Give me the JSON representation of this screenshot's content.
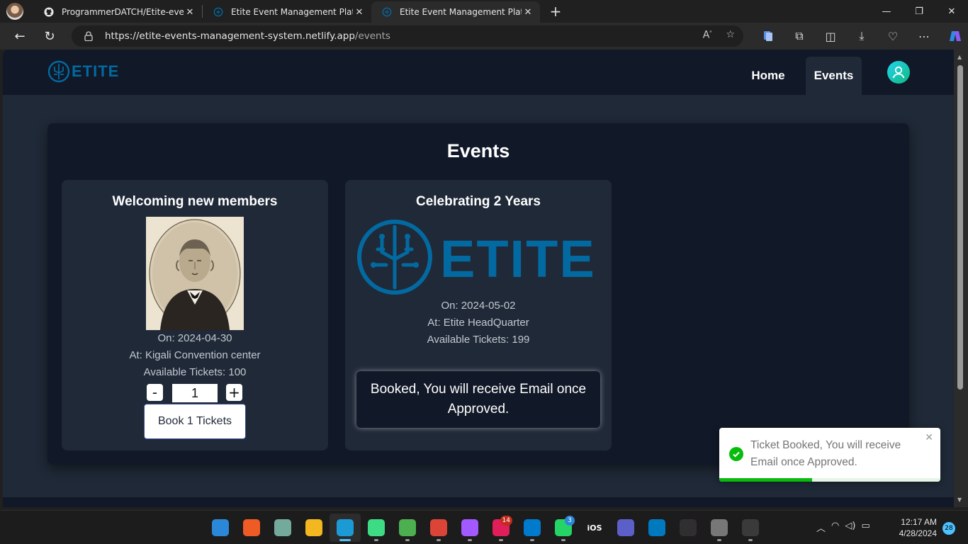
{
  "browser": {
    "tabs": [
      {
        "title": "ProgrammerDATCH/Etite-event-m",
        "icon": "github-icon"
      },
      {
        "title": "Etite Event Management Platform",
        "icon": "etite-favicon"
      },
      {
        "title": "Etite Event Management Platform",
        "icon": "etite-favicon",
        "active": true
      }
    ],
    "url_host": "https://etite-events-management-system.netlify.app",
    "url_path": "/events"
  },
  "site": {
    "logo_text": "ETITE",
    "nav": {
      "home": "Home",
      "events": "Events"
    },
    "page_title": "Events"
  },
  "events": [
    {
      "title": "Welcoming new members",
      "date": "On: 2024-04-30",
      "location": "At: Kigali Convention center",
      "tickets": "Available Tickets: 100",
      "qty": "1",
      "minus": "-",
      "plus": "+",
      "book_label": "Book 1 Tickets"
    },
    {
      "title": "Celebrating 2 Years",
      "banner_text": "ETITE",
      "date": "On: 2024-05-02",
      "location": "At: Etite HeadQuarter",
      "tickets": "Available Tickets: 199",
      "booked_message": "Booked, You will receive Email once Approved."
    }
  ],
  "toast": {
    "message": "Ticket Booked, You will receive Email once Approved.",
    "progress": 0.42,
    "color": "#07bc0c"
  },
  "taskbar": {
    "apps": [
      {
        "name": "start-icon",
        "color": "#2b88d8",
        "label": ""
      },
      {
        "name": "postman-icon",
        "color": "#ef5b25",
        "label": ""
      },
      {
        "name": "chatgpt-icon",
        "color": "#74aa9c",
        "label": ""
      },
      {
        "name": "file-explorer-icon",
        "color": "#f3b81f",
        "label": ""
      },
      {
        "name": "edge-icon",
        "color": "#1c9ad6",
        "label": "",
        "active": true
      },
      {
        "name": "android-studio-icon",
        "color": "#3ddc84",
        "label": ""
      },
      {
        "name": "metamask-icon",
        "color": "#4caf50",
        "label": ""
      },
      {
        "name": "chrome-icon",
        "color": "#db4437",
        "label": ""
      },
      {
        "name": "figma-icon",
        "color": "#a259ff",
        "label": ""
      },
      {
        "name": "slack-icon",
        "color": "#e01e5a",
        "label": "",
        "badge": "14",
        "badge_color": "#c42b1c"
      },
      {
        "name": "vscode-icon",
        "color": "#007acc",
        "label": ""
      },
      {
        "name": "whatsapp-icon",
        "color": "#25d366",
        "label": "",
        "badge": "3",
        "badge_color": "#2b88d8"
      },
      {
        "name": "ios-icon",
        "color": "#1c1c1c",
        "label": "iOS"
      },
      {
        "name": "teams-icon",
        "color": "#5b5fc7",
        "label": ""
      },
      {
        "name": "trello-icon",
        "color": "#0079bf",
        "label": ""
      },
      {
        "name": "obs-icon",
        "color": "#302e31",
        "label": ""
      },
      {
        "name": "settings-icon",
        "color": "#777777",
        "label": ""
      },
      {
        "name": "terminal-icon",
        "color": "#3a3a3a",
        "label": ""
      }
    ],
    "time": "12:17 AM",
    "date": "4/28/2024",
    "notifications": "28"
  }
}
